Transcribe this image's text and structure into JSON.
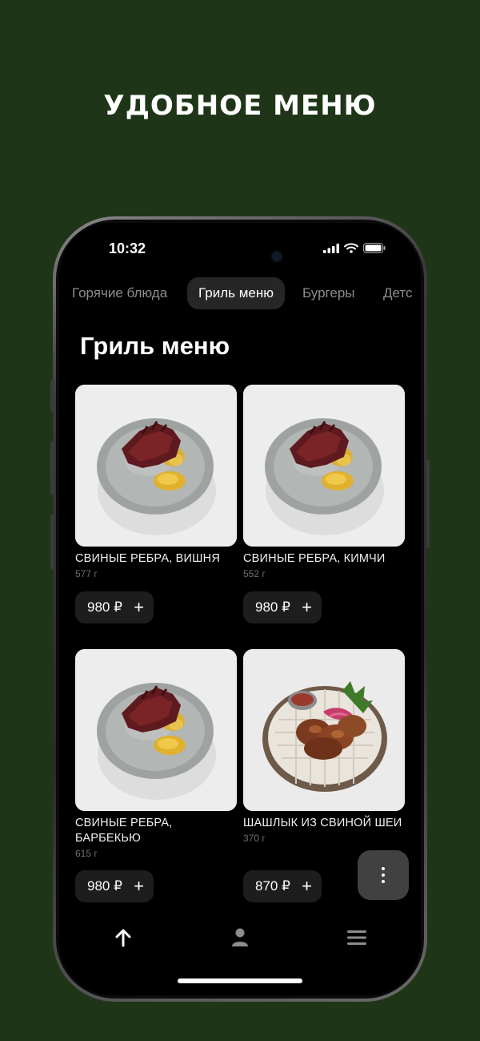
{
  "promo": {
    "title": "УДОБНОЕ МЕНЮ"
  },
  "status_bar": {
    "time": "10:32",
    "icons": [
      "cellular-signal-icon",
      "wifi-icon",
      "battery-icon"
    ]
  },
  "tabs": [
    {
      "label": "Горячие блюда",
      "active": false
    },
    {
      "label": "Гриль меню",
      "active": true
    },
    {
      "label": "Бургеры",
      "active": false
    },
    {
      "label": "Детс",
      "active": false
    }
  ],
  "section_title": "Гриль меню",
  "products": [
    {
      "name": "СВИНЫЕ РЕБРА, ВИШНЯ",
      "weight": "577 г",
      "price": "980 ₽",
      "add_icon": "plus-icon",
      "photo": "ribs-on-plate"
    },
    {
      "name": "СВИНЫЕ РЕБРА, КИМЧИ",
      "weight": "552 г",
      "price": "980 ₽",
      "add_icon": "plus-icon",
      "photo": "ribs-on-plate"
    },
    {
      "name": "СВИНЫЕ РЕБРА, БАРБЕКЬЮ",
      "weight": "615 г",
      "price": "980 ₽",
      "add_icon": "plus-icon",
      "photo": "ribs-on-plate"
    },
    {
      "name": "ШАШЛЫК ИЗ СВИНОЙ ШЕИ",
      "weight": "370 г",
      "price": "870 ₽",
      "add_icon": "plus-icon",
      "photo": "shashlik-on-plate"
    }
  ],
  "fab": {
    "icon": "more-vertical-icon"
  },
  "bottom_nav": [
    {
      "icon": "arrow-up-icon",
      "active": true
    },
    {
      "icon": "profile-icon",
      "active": false
    },
    {
      "icon": "menu-icon",
      "active": false
    }
  ],
  "colors": {
    "background": "#1e3617",
    "screen": "#000000",
    "active_tab": "#262626",
    "price_button": "#1d1d1d",
    "fab": "#414141"
  }
}
